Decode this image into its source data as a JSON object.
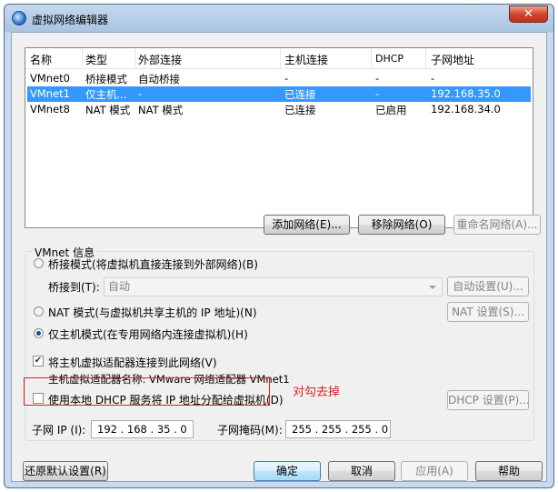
{
  "window": {
    "title": "虚拟网络编辑器",
    "close_glyph": "✕"
  },
  "table": {
    "headers": [
      "名称",
      "类型",
      "外部连接",
      "主机连接",
      "DHCP",
      "子网地址"
    ],
    "rows": [
      [
        "VMnet0",
        "桥接模式",
        "自动桥接",
        "-",
        "-",
        "-"
      ],
      [
        "VMnet1",
        "仅主机...",
        "-",
        "已连接",
        "-",
        "192.168.35.0"
      ],
      [
        "VMnet8",
        "NAT 模式",
        "NAT 模式",
        "已连接",
        "已启用",
        "192.168.34.0"
      ]
    ],
    "selected_row": 1
  },
  "list_buttons": {
    "add": "添加网络(E)...",
    "remove": "移除网络(O)",
    "rename": "重命名网络(A)..."
  },
  "vmnet_info": {
    "title": "VMnet 信息",
    "bridged_label": "桥接模式(将虚拟机直接连接到外部网络)(B)",
    "bridge_to_label": "桥接到(T):",
    "bridge_to_value": "自动",
    "auto_settings": "自动设置(U)...",
    "nat_label": "NAT 模式(与虚拟机共享主机的 IP 地址)(N)",
    "nat_settings": "NAT 设置(S)...",
    "hostonly_label": "仅主机模式(在专用网络内连接虚拟机)(H)",
    "connect_adapter_label": "将主机虚拟适配器连接到此网络(V)",
    "adapter_name_label": "主机虚拟适配器名称: VMware 网络适配器 VMnet1",
    "dhcp_label": "使用本地 DHCP 服务将 IP 地址分配给虚拟机(D)",
    "dhcp_settings": "DHCP 设置(P)...",
    "subnet_ip_label": "子网 IP (I):",
    "subnet_ip_value": "192 . 168 . 35 . 0",
    "subnet_mask_label": "子网掩码(M):",
    "subnet_mask_value": "255 . 255 . 255 . 0",
    "mode": "hostonly",
    "connect_adapter_checked": true,
    "dhcp_checked": false
  },
  "annotation": {
    "text": "对勾去掉",
    "color": "#e02020"
  },
  "footer": {
    "restore": "还原默认设置(R)",
    "ok": "确定",
    "cancel": "取消",
    "apply": "应用(A)",
    "help": "帮助"
  },
  "colors": {
    "selection": "#3399ff",
    "close": "#c23016"
  }
}
